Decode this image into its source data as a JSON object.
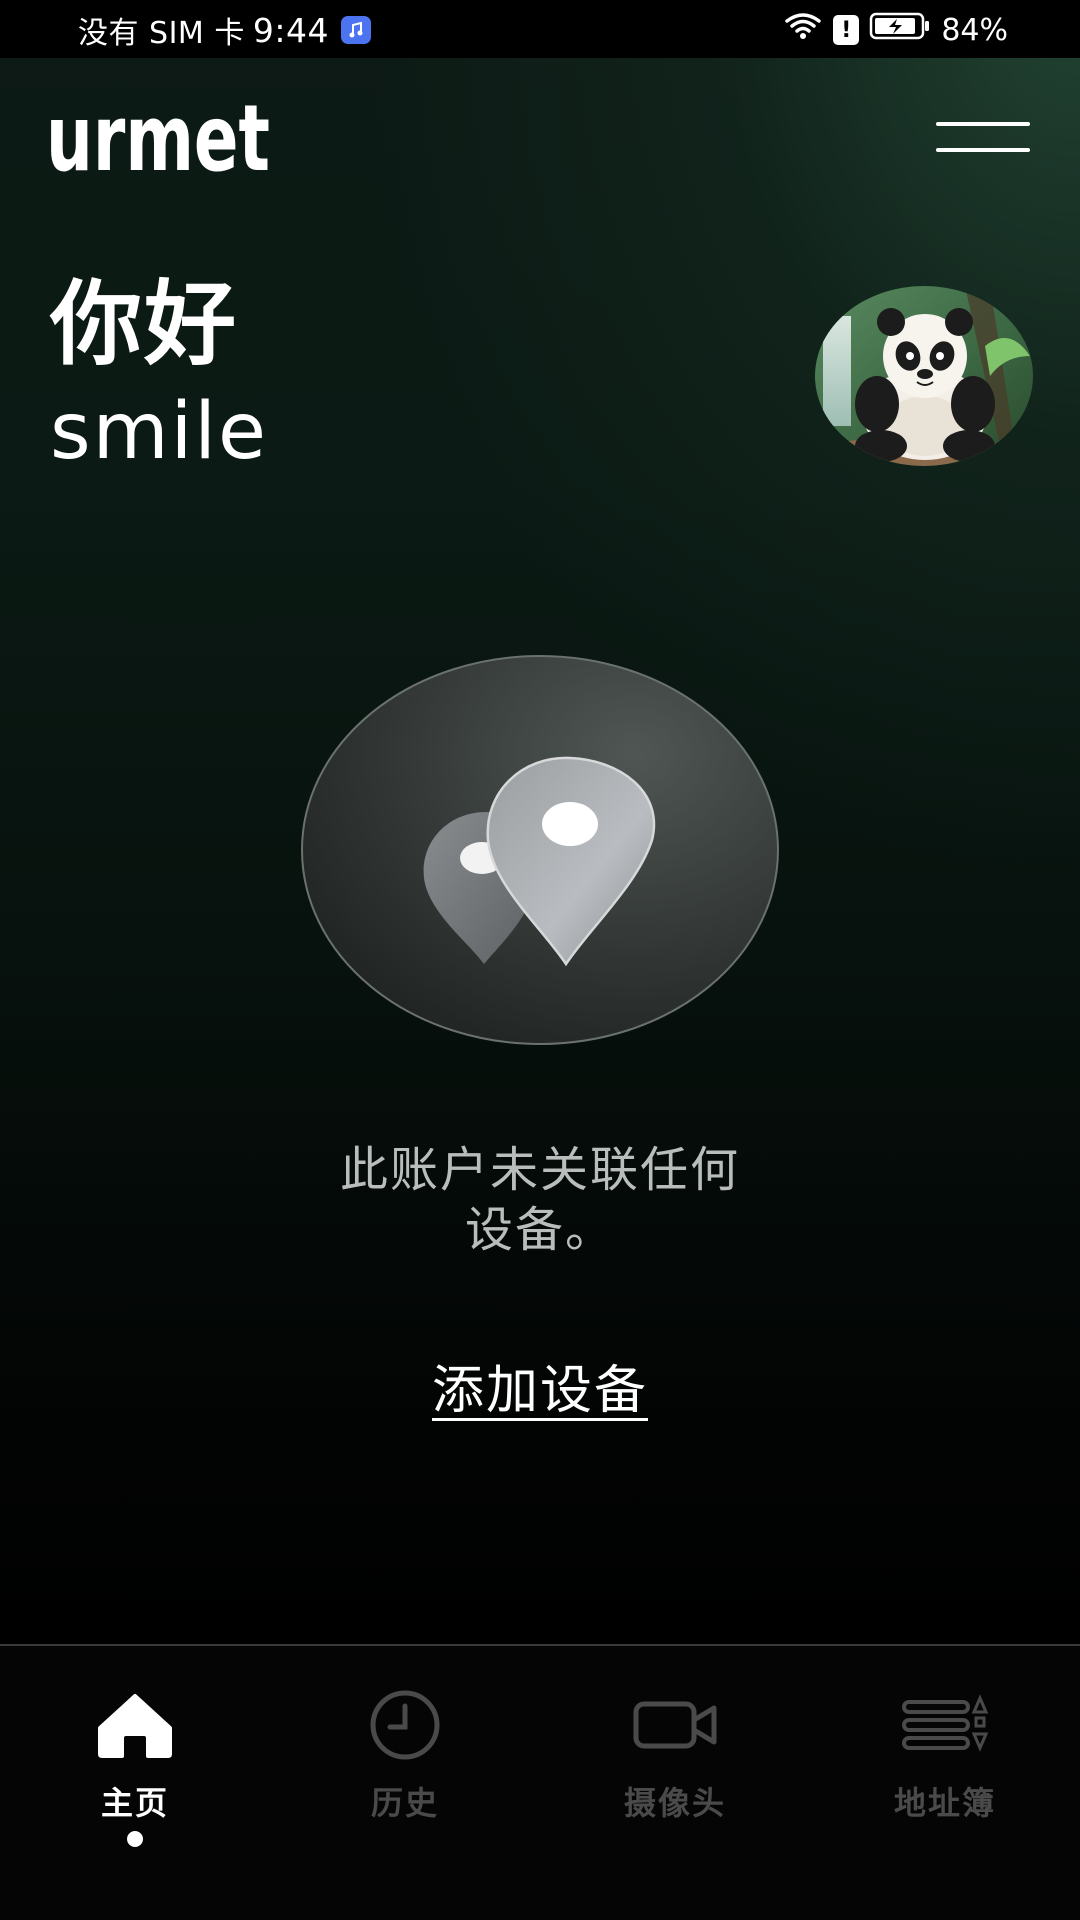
{
  "status_bar": {
    "carrier": "没有 SIM 卡",
    "time": "9:44",
    "battery": "84%",
    "alert_glyph": "!"
  },
  "header": {
    "logo_text": "urmet",
    "menu_icon": "hamburger-menu-icon"
  },
  "greeting": {
    "hello": "你好",
    "username": "smile"
  },
  "avatar": {
    "icon": "panda-avatar"
  },
  "empty_state": {
    "message_line1": "此账户未关联任何",
    "message_line2": "设备。",
    "add_device_label": "添加设备",
    "illustration_icon": "location-pins-icon"
  },
  "bottom_nav": {
    "items": [
      {
        "label": "主页",
        "icon": "home-icon",
        "active": true
      },
      {
        "label": "历史",
        "icon": "clock-icon",
        "active": false
      },
      {
        "label": "摄像头",
        "icon": "camera-icon",
        "active": false
      },
      {
        "label": "地址簿",
        "icon": "address-book-icon",
        "active": false
      }
    ]
  },
  "colors": {
    "accent_green": "#264a38",
    "inactive_nav": "#4a4a4a",
    "text_muted": "#b9bdbb"
  }
}
